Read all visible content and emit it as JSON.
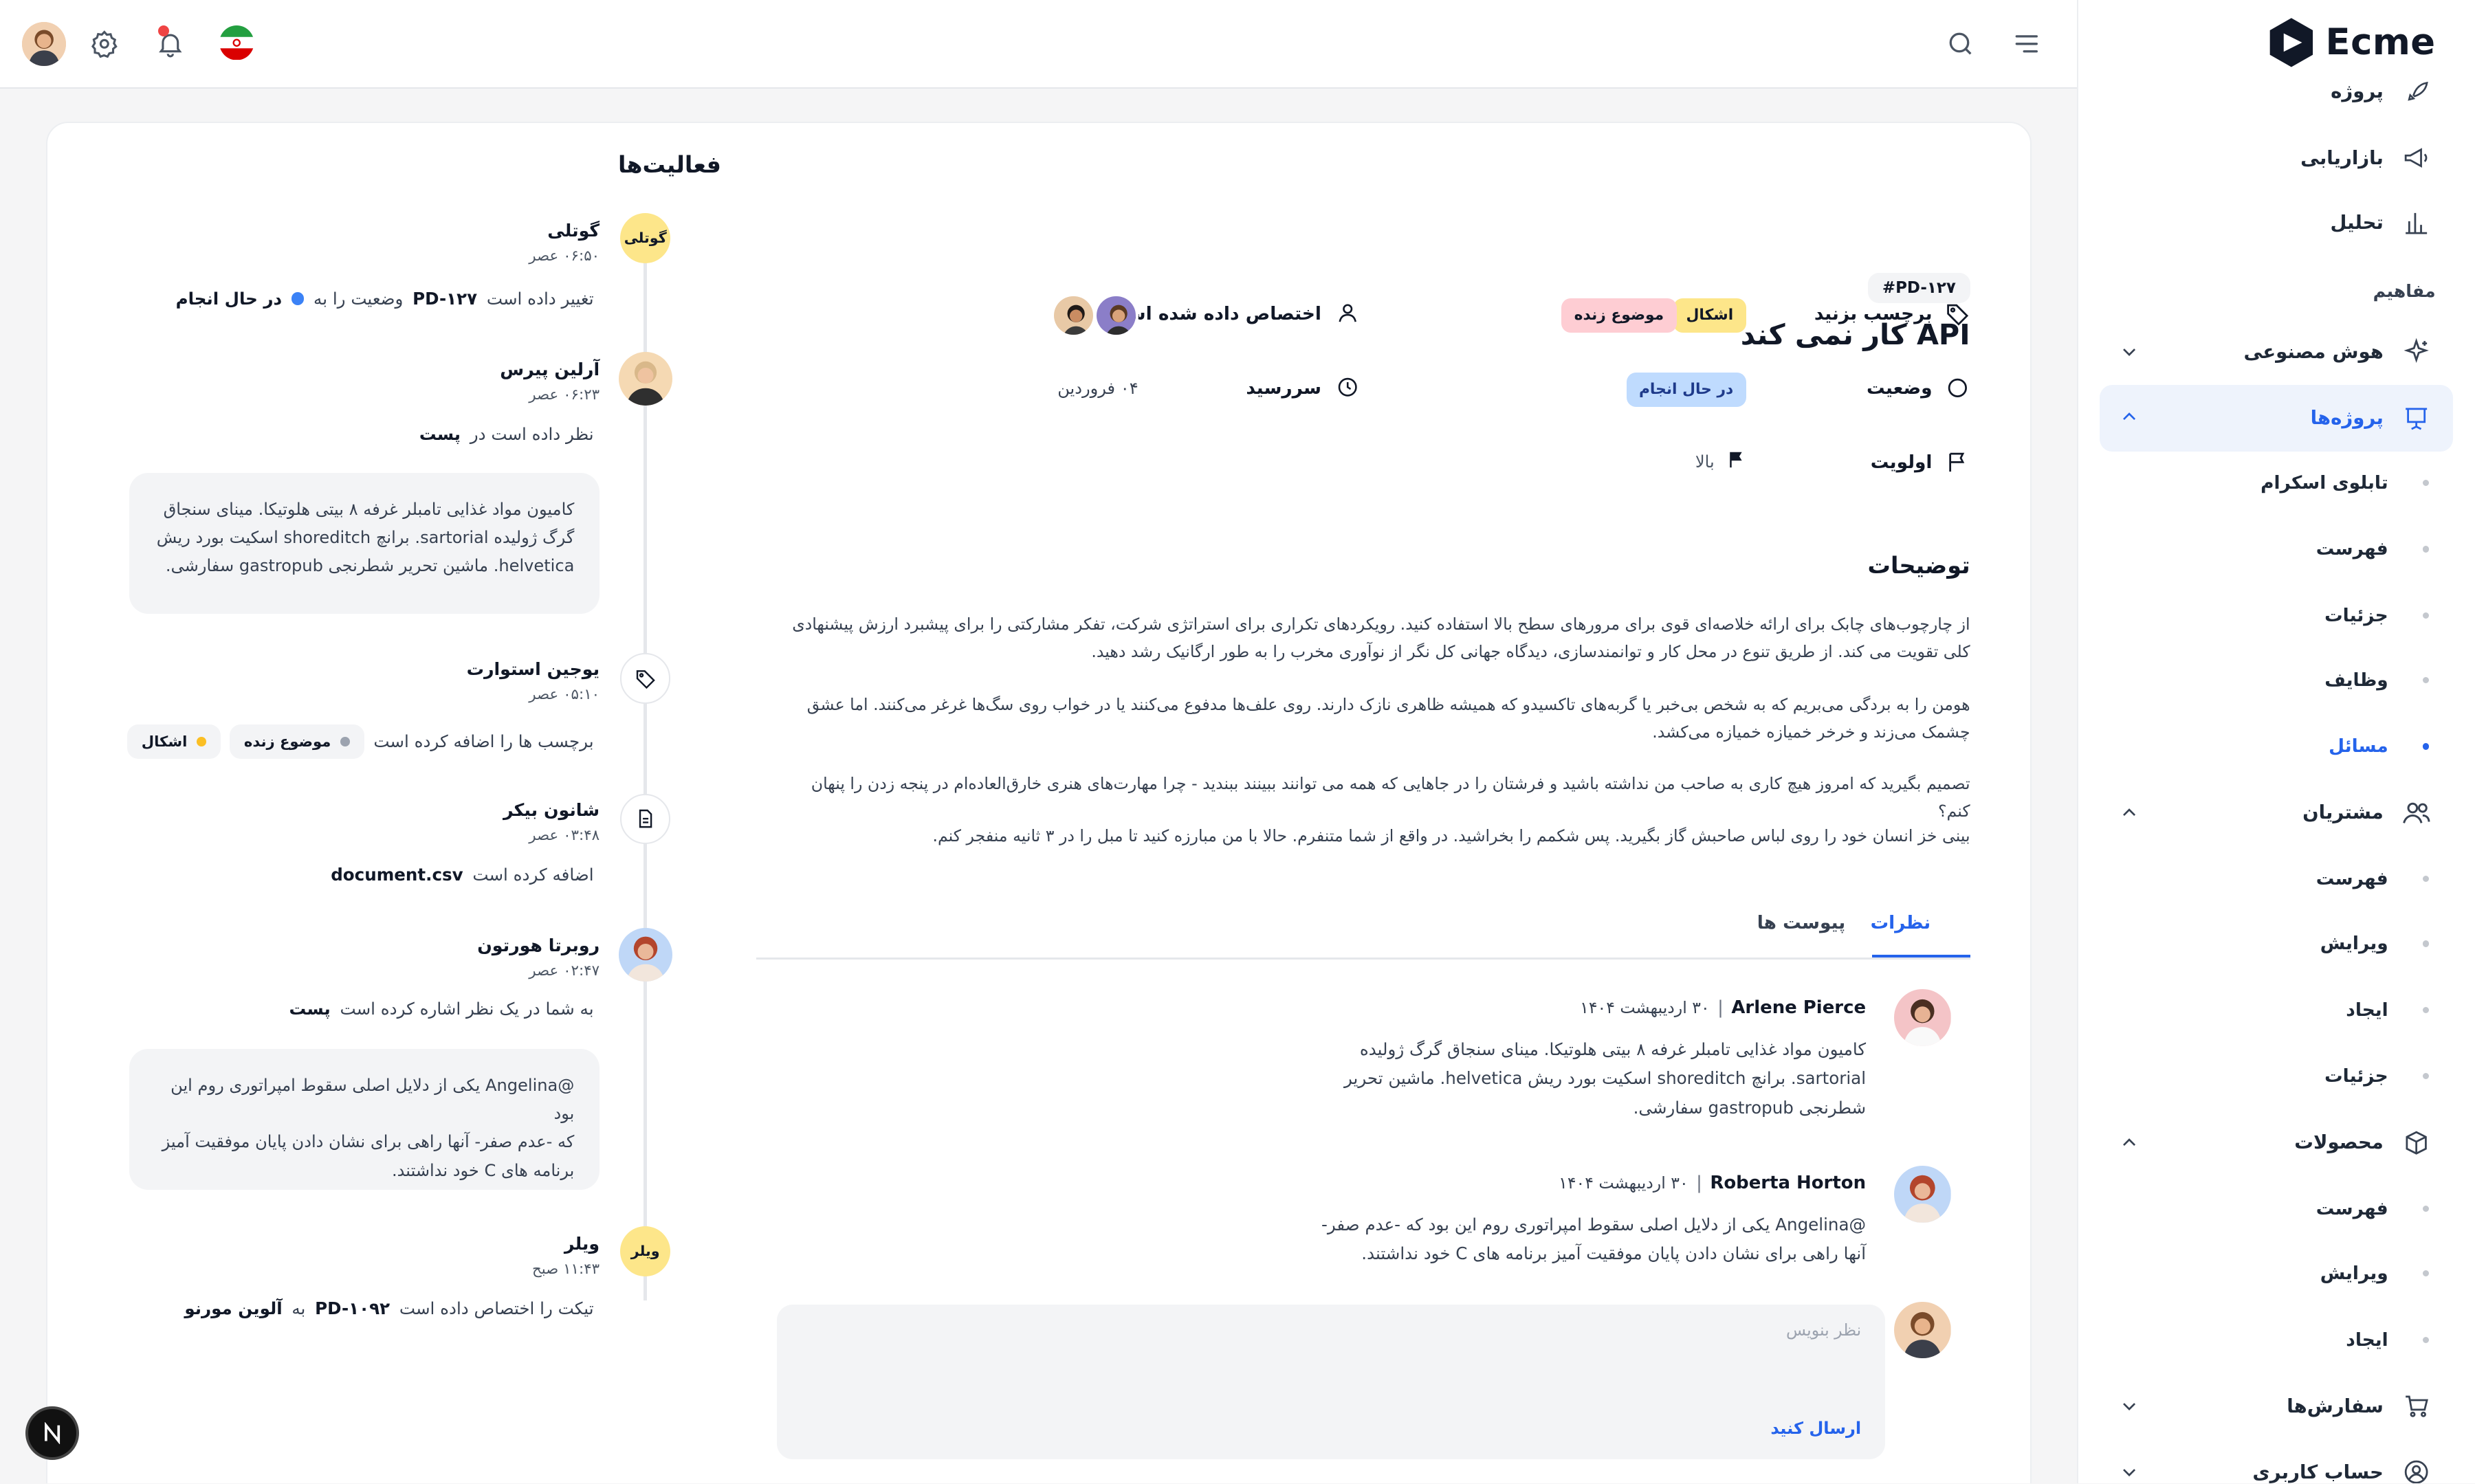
{
  "brand": {
    "name": "Ecme"
  },
  "sidebar": {
    "items": [
      {
        "label": "پروژه"
      },
      {
        "label": "بازاریابی"
      },
      {
        "label": "تحلیل"
      }
    ],
    "section_title": "مفاهیم",
    "ai": {
      "label": "هوش مصنوعی"
    },
    "projects": {
      "label": "پروژه‌ها",
      "sub": [
        "تابلوی اسکرام",
        "فهرست",
        "جزئیات",
        "وظایف",
        "مسائل"
      ],
      "active_sub": "مسائل"
    },
    "customers": {
      "label": "مشتریان",
      "sub": [
        "فهرست",
        "ویرایش",
        "ایجاد",
        "جزئیات"
      ]
    },
    "products": {
      "label": "محصولات",
      "sub": [
        "فهرست",
        "ویرایش",
        "ایجاد"
      ]
    },
    "orders": {
      "label": "سفارش‌ها"
    },
    "account": {
      "label": "حساب کاربری"
    }
  },
  "header": {
    "icons": [
      "menu-icon",
      "search-icon",
      "flag-icon",
      "notification-icon",
      "settings-icon",
      "avatar"
    ]
  },
  "issue": {
    "id": "#PD-۱۲۷",
    "title": "API کار نمی کند",
    "labels_title": "برچسب بزنید",
    "labels": [
      {
        "text": "اشکال",
        "bg": "#fde68a",
        "fg": "#111827"
      },
      {
        "text": "موضوع زنده",
        "bg": "#fecdd3",
        "fg": "#111827"
      }
    ],
    "assigned_title": "اختصاص داده شده است",
    "status_title": "وضعیت",
    "status_value": "در حال انجام",
    "due_title": "سررسید",
    "due_value": "۰۴ فروردین",
    "priority_title": "اولویت",
    "priority_value": "بالا",
    "description_title": "توضیحات",
    "paragraphs": [
      "از چارچوب‌های چابک برای ارائه خلاصه‌ای قوی برای مرورهای سطح بالا استفاده کنید. رویکردهای تکراری برای استراتژی شرکت، تفکر مشارکتی را برای پیشبرد ارزش پیشنهادی کلی تقویت می کند. از طریق تنوع در محل کار و توانمندسازی، دیدگاه جهانی کل نگر از نوآوری مخرب را به طور ارگانیک رشد دهید.",
      "هومن را به بردگی می‌بریم که به شخص بی‌خبر یا گربه‌های تاکسیدو که همیشه ظاهری نازک دارند. روی علف‌ها مدفوع می‌کنند یا در خواب روی سگ‌ها غرغر می‌کنند. اما عشق چشمک می‌زند و خرخر خمیازه خمیازه می‌کشد.",
      "تصمیم بگیرید که امروز هیچ کاری به صاحب من نداشته باشید و فرشتان را در جاهایی که همه می توانند ببینند ببندید - چرا مهارت‌های هنری خارق‌العاده‌ام در پنجه زدن را پنهان کنم؟",
      "بینی خز انسان خود را روی لباس صاحبش گاز بگیرید. پس شکمم را بخراشید. در واقع از شما متنفرم. حالا با من مبارزه کنید تا مبل را در ۳ ثانیه منفجر کنم."
    ],
    "tabs": [
      {
        "label": "نظرات"
      },
      {
        "label": "پیوست ها"
      }
    ],
    "comments": [
      {
        "name": "Arlene Pierce",
        "date": "۳۰ اردیبهشت ۱۴۰۴",
        "lines": [
          "کامیون مواد غذایی تامبلر غرفه ۸ بیتی هلوتیکا. مینای سنجاق گرگ ژولیده",
          "sartorial. برانچ shoreditch اسکیت بورد ریش helvetica. ماشین تحریر",
          "شطرنجی gastropub سفارشی."
        ]
      },
      {
        "name": "Roberta Horton",
        "date": "۳۰ اردیبهشت ۱۴۰۴",
        "lines": [
          "@Angelina یکی از دلایل اصلی سقوط امپراتوری روم این بود که -عدم صفر-",
          "آنها راهی برای نشان دادن پایان موفقیت آمیز برنامه های C خود نداشتند."
        ]
      }
    ],
    "comment_placeholder": "نظر بنویس",
    "send_label": "ارسال کنید"
  },
  "activities": {
    "title": "فعالیت‌ها",
    "items": [
      {
        "name": "گوتلی",
        "badge": "گوتلی",
        "time": "۰۶:۵۰ عصر",
        "action": "تغییر داده است",
        "ref": "PD-۱۲۷",
        "action2": "وضعیت را به",
        "status": "در حال انجام",
        "status_color": "#3b82f6"
      },
      {
        "name": "آرلین پیرس",
        "time": "۰۶:۲۳ عصر",
        "action": "نظر داده است در",
        "ref": "پست",
        "box": [
          "کامیون مواد غذایی تامبلر غرفه ۸ بیتی هلوتیکا. مینای سنجاق",
          "گرگ ژولیده sartorial. برانچ shoreditch اسکیت بورد ریش",
          "helvetica. ماشین تحریر شطرنجی gastropub سفارشی."
        ]
      },
      {
        "name": "یوجین استوارت",
        "time": "۰۵:۱۰ عصر",
        "action": "برچسب ها را اضافه کرده است",
        "tags": [
          {
            "text": "موضوع زنده",
            "color": "#9ca3af"
          },
          {
            "text": "اشکال",
            "color": "#fbbf24"
          }
        ]
      },
      {
        "name": "شانون بیکر",
        "time": "۰۳:۴۸ عصر",
        "action": "اضافه کرده است",
        "ref": "document.csv"
      },
      {
        "name": "روبرتا هورتون",
        "time": "۰۲:۴۷ عصر",
        "action": "به شما در یک نظر اشاره کرده است",
        "ref": "پست",
        "box": [
          "@Angelina یکی از دلایل اصلی سقوط امپراتوری روم این بود",
          "که -عدم صفر- آنها راهی برای نشان دادن پایان موفقیت آمیز",
          "برنامه های C خود نداشتند."
        ]
      },
      {
        "name": "ویلر",
        "badge": "ویلر",
        "time": "۱۱:۴۳ صبح",
        "action": "تیکت را اختصاص داده است",
        "ref": "PD-۱۰۹۲",
        "action2": "به",
        "target": "آلوین مورنو"
      }
    ]
  },
  "colors": {
    "accent": "#2563eb",
    "badge_yellow": "#fde68a",
    "badge_pink": "#fecdd3",
    "status_blue_bg": "#bfdbfe"
  }
}
